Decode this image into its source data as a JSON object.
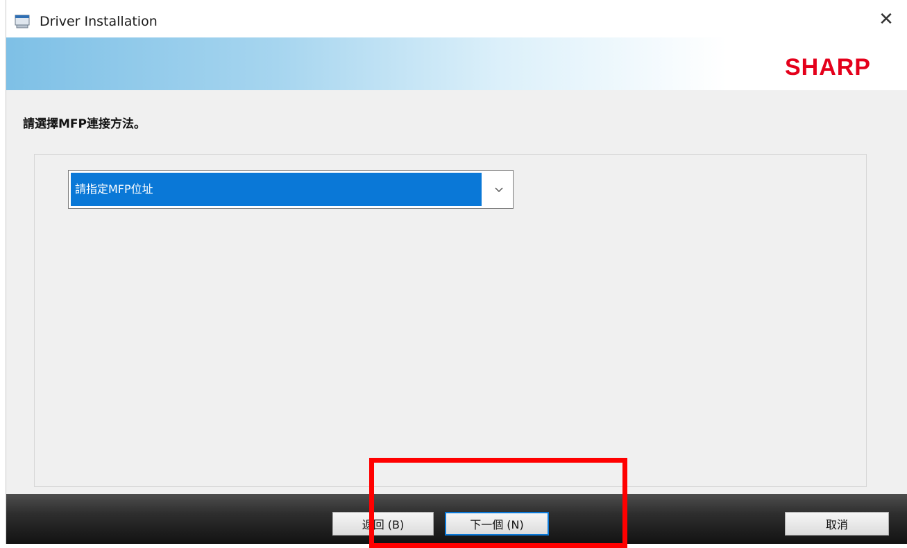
{
  "window": {
    "title": "Driver Installation",
    "icon": "printer-icon",
    "close_symbol": "✕"
  },
  "banner": {
    "brand": "SHARP",
    "brand_color": "#e4001b"
  },
  "content": {
    "instruction": "請選擇MFP連接方法。",
    "connection_select": {
      "selected_value": "請指定MFP位址",
      "arrow_symbol": "⌄"
    }
  },
  "footer": {
    "back_label": "返回 (B)",
    "next_label": "下一個 (N)",
    "cancel_label": "取消"
  },
  "colors": {
    "accent": "#0a78d7",
    "highlight": "#ff0000"
  }
}
